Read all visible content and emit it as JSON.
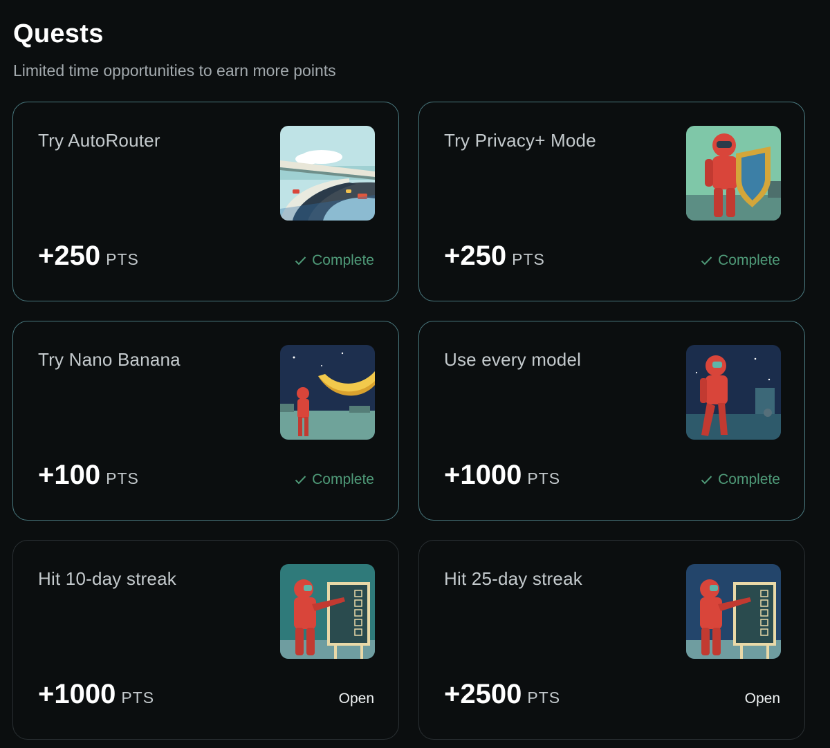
{
  "header": {
    "title": "Quests",
    "subtitle": "Limited time opportunities to earn more points"
  },
  "points_unit": "PTS",
  "colors": {
    "complete": "#4f9a78",
    "card_border_complete": "#4a7a80",
    "card_border_open": "#2a3033"
  },
  "quests": [
    {
      "name": "Try AutoRouter",
      "points": "+250",
      "status": "Complete",
      "image": "highway-illustration"
    },
    {
      "name": "Try Privacy+ Mode",
      "points": "+250",
      "status": "Complete",
      "image": "astronaut-shield-illustration"
    },
    {
      "name": "Try Nano Banana",
      "points": "+100",
      "status": "Complete",
      "image": "astronaut-banana-illustration"
    },
    {
      "name": "Use every model",
      "points": "+1000",
      "status": "Complete",
      "image": "astronaut-walking-illustration"
    },
    {
      "name": "Hit 10-day streak",
      "points": "+1000",
      "status": "Open",
      "image": "astronaut-checklist-illustration"
    },
    {
      "name": "Hit 25-day streak",
      "points": "+2500",
      "status": "Open",
      "image": "astronaut-checklist-illustration"
    }
  ]
}
